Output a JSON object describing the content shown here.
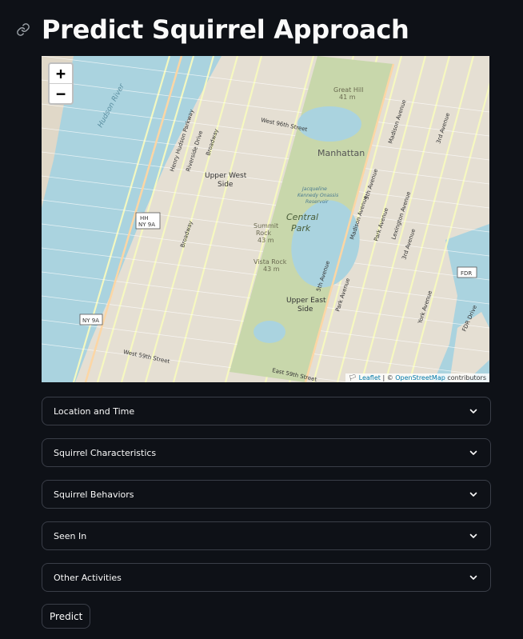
{
  "header": {
    "title": "Predict Squirrel Approach",
    "link_icon": "link-icon"
  },
  "map": {
    "zoom_in": "+",
    "zoom_out": "−",
    "attribution_flag": "🏳",
    "attribution_leaflet": "Leaflet",
    "attribution_sep": " | © ",
    "attribution_osm": "OpenStreetMap",
    "attribution_tail": " contributors",
    "labels": {
      "manhattan": "Manhattan",
      "upper_west_side_1": "Upper West",
      "upper_west_side_2": "Side",
      "upper_east_side_1": "Upper East",
      "upper_east_side_2": "Side",
      "central_park_1": "Central",
      "central_park_2": "Park",
      "summit_rock_1": "Summit",
      "summit_rock_2": "Rock",
      "summit_rock_3": "43 m",
      "vista_rock_1": "Vista Rock",
      "vista_rock_2": "43 m",
      "great_hill_1": "Great Hill",
      "great_hill_2": "41 m",
      "hh": "HH",
      "ny9a_1": "NY 9A",
      "ny9a_2": "NY 9A",
      "fdr": "FDR",
      "w96": "West 96th Street",
      "w59": "West 59th Street",
      "e59": "East 59th Street",
      "broadway": "Broadway",
      "broadway2": "Broadway",
      "riverside": "Riverside Drive",
      "hudson_pkwy": "Henry Hudson Parkway",
      "fifth_ave": "5th Avenue",
      "fifth_ave2": "5th Avenue",
      "park_ave": "Park Avenue",
      "park_ave2": "Park Avenue",
      "madison_ave": "Madison Avenue",
      "madison_ave2": "Madison Avenue",
      "lexington": "Lexington Avenue",
      "third_ave": "3rd Avenue",
      "third_ave2": "3rd Avenue",
      "york_ave": "York Avenue",
      "fdr_drive": "FDR Drive",
      "hudson_river": "Hudson River",
      "reservoir_1": "Jacqueline",
      "reservoir_2": "Kennedy Onassis",
      "reservoir_3": "Reservoir"
    }
  },
  "expanders": [
    {
      "label": "Location and Time"
    },
    {
      "label": "Squirrel Characteristics"
    },
    {
      "label": "Squirrel Behaviors"
    },
    {
      "label": "Seen In"
    },
    {
      "label": "Other Activities"
    }
  ],
  "predict_button": "Predict",
  "colors": {
    "background": "#0e1117",
    "border": "#3a3e48",
    "water": "#aad3df",
    "park": "#c8d7ab",
    "land": "#e5dfd3",
    "road": "#f7fabf"
  }
}
